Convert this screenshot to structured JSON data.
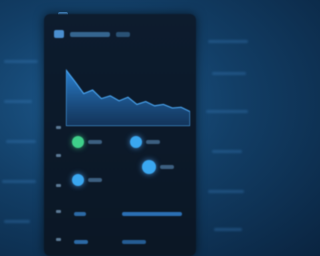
{
  "screen": {
    "accent": "#3aa7f0",
    "success": "#3fd08a",
    "panel_bg": "#0d1c2e"
  },
  "panel": {
    "header_icon": "folder-icon",
    "chart_data": {
      "type": "area",
      "values": [
        78,
        62,
        45,
        50,
        38,
        42,
        35,
        40,
        30,
        34,
        28,
        30,
        25,
        26,
        20
      ],
      "ylim": [
        0,
        100
      ],
      "grid": false
    },
    "tiles": [
      {
        "icon": "status-dot-icon",
        "color": "#3fd08a"
      },
      {
        "icon": "status-dot-icon",
        "color": "#3aa7f0"
      },
      {
        "icon": "status-dot-icon",
        "color": "#3aa7f0"
      },
      {
        "icon": "status-dot-icon",
        "color": "#3aa7f0"
      }
    ]
  }
}
